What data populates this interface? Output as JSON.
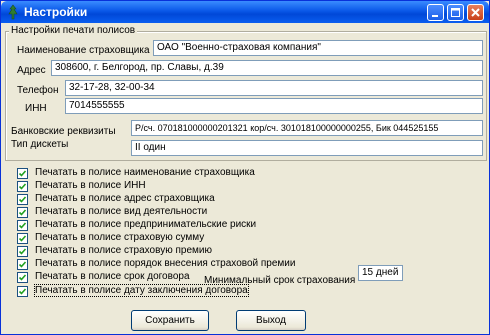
{
  "window": {
    "title": "Настройки"
  },
  "group": {
    "legend": "Настройки печати полисов"
  },
  "fields": [
    {
      "label": "Наименование страховщика",
      "value": "ОАО \"Военно-страховая компания\""
    },
    {
      "label": "Адрес",
      "value": "308600, г. Белгород, пр. Славы, д.39"
    },
    {
      "label": "Телефон",
      "value": "32-17-28, 32-00-34"
    },
    {
      "label": "ИНН",
      "value": "7014555555"
    },
    {
      "label": "Банковские реквизиты",
      "value": "Р/сч. 070181000000201321 кор/сч. 301018100000000255, Бик 044525155"
    },
    {
      "label": "Тип дискеты",
      "value": "II один"
    }
  ],
  "checkboxes": [
    {
      "label": "Печатать в полисе наименование страховщика",
      "checked": true
    },
    {
      "label": "Печатать в полисе ИНН",
      "checked": true
    },
    {
      "label": "Печатать в полисе адрес страховщика",
      "checked": true
    },
    {
      "label": "Печатать в полисе вид деятельности",
      "checked": true
    },
    {
      "label": "Печатать в полисе предпринимательские риски",
      "checked": true
    },
    {
      "label": "Печатать в полисе страховую сумму",
      "checked": true
    },
    {
      "label": "Печатать в полисе страховую премию",
      "checked": true
    },
    {
      "label": "Печатать в полисе порядок внесения страховой премии",
      "checked": true
    },
    {
      "label": "Печатать в полисе срок договора",
      "checked": true
    },
    {
      "label": "Печатать в полисе дату заключения договора",
      "checked": true
    }
  ],
  "min_term": {
    "label": "Минимальный срок страхования",
    "value": "15 дней"
  },
  "buttons": {
    "save": "Сохранить",
    "exit": "Выход"
  }
}
